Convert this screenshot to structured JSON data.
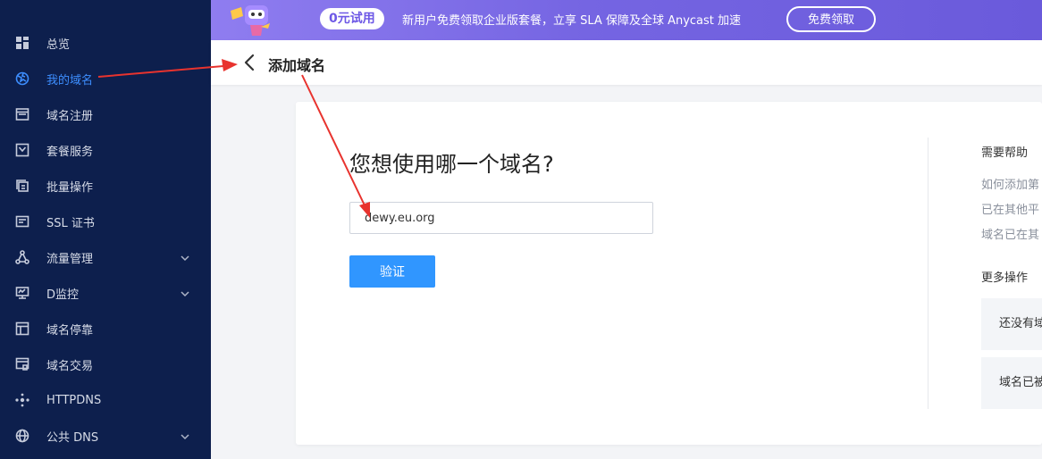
{
  "sidebar": {
    "items": [
      {
        "label": "总览",
        "icon": "dashboard-icon"
      },
      {
        "label": "我的域名",
        "icon": "globe-icon",
        "active": true
      },
      {
        "label": "域名注册",
        "icon": "browser-icon"
      },
      {
        "label": "套餐服务",
        "icon": "package-icon"
      },
      {
        "label": "批量操作",
        "icon": "stack-icon"
      },
      {
        "label": "SSL 证书",
        "icon": "certificate-icon"
      },
      {
        "label": "流量管理",
        "icon": "flow-icon",
        "expandable": true
      },
      {
        "label": "D监控",
        "icon": "monitor-icon",
        "expandable": true
      },
      {
        "label": "域名停靠",
        "icon": "layout-icon"
      },
      {
        "label": "域名交易",
        "icon": "trade-icon"
      },
      {
        "label": "HTTPDNS",
        "icon": "nodes-icon"
      },
      {
        "label": "公共 DNS",
        "icon": "public-globe-icon",
        "expandable": true
      }
    ]
  },
  "banner": {
    "badge": "0元试用",
    "text": "新用户免费领取企业版套餐，立享 SLA 保障及全球 Anycast 加速",
    "button": "免费领取"
  },
  "header": {
    "title": "添加域名"
  },
  "main": {
    "question": "您想使用哪一个域名?",
    "input_value": "dewy.eu.org",
    "verify_button": "验证"
  },
  "help": {
    "title": "需要帮助",
    "links": [
      "如何添加第",
      "已在其他平",
      "域名已在其"
    ],
    "more_title": "更多操作",
    "more_items": [
      "还没有域",
      "域名已被"
    ]
  },
  "colors": {
    "sidebar_bg": "#0d1f4d",
    "active": "#3d8eff",
    "primary_button": "#3096ff",
    "annotation_arrow": "#e8332e"
  }
}
